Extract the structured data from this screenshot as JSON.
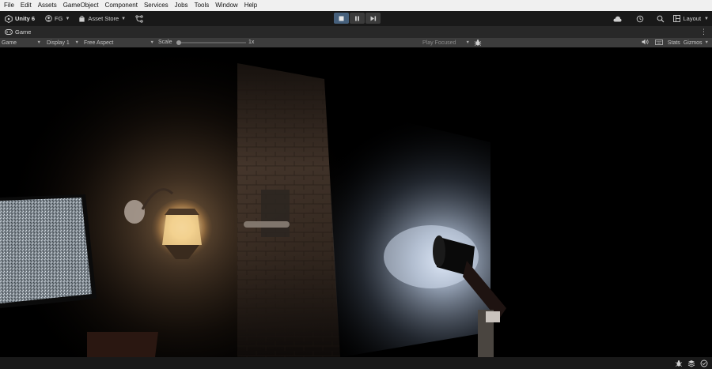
{
  "menu": [
    "File",
    "Edit",
    "Assets",
    "GameObject",
    "Component",
    "Services",
    "Jobs",
    "Tools",
    "Window",
    "Help"
  ],
  "toolbar": {
    "unity_label": "Unity 6",
    "account_label": "FG",
    "asset_store_label": "Asset Store",
    "layout_label": "Layout"
  },
  "tabs": {
    "game_tab_label": "Game"
  },
  "game_toolbar": {
    "view_mode": "Game",
    "display": "Display 1",
    "aspect": "Free Aspect",
    "scale_label": "Scale",
    "scale_value": "1x",
    "play_mode": "Play Focused",
    "stats_label": "Stats",
    "gizmos_label": "Gizmos"
  },
  "colors": {
    "menubar_bg": "#f0f0f0",
    "toolbar_bg": "#191919",
    "tab_bg": "#282828",
    "game_toolbar_bg": "#3c3c3c",
    "play_active": "#46607c"
  }
}
